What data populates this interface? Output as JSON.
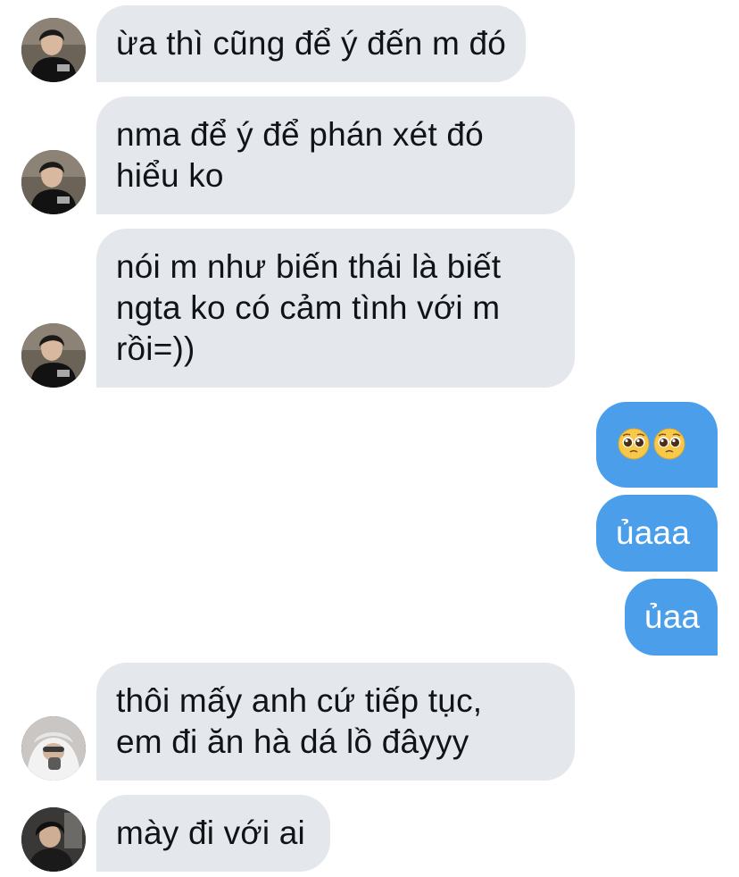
{
  "colors": {
    "incoming_bubble": "#e4e8ec",
    "outgoing_bubble": "#4b9ee9",
    "incoming_text": "#111417",
    "outgoing_text": "#ffffff"
  },
  "messages": [
    {
      "direction": "incoming",
      "sender_avatar": "avatar-boy-black-hoodie",
      "lines": [
        "ừa thì cũng để ý đến m đó"
      ]
    },
    {
      "direction": "incoming",
      "sender_avatar": "avatar-boy-black-hoodie",
      "lines": [
        "nma để ý để phán xét đó",
        "hiểu ko"
      ]
    },
    {
      "direction": "incoming",
      "sender_avatar": "avatar-boy-black-hoodie",
      "lines": [
        "nói m như biến thái là biết",
        "ngta ko có cảm tình với m",
        "rồi=))"
      ]
    },
    {
      "direction": "outgoing",
      "emoji": [
        "pleading-face-emoji",
        "pleading-face-emoji"
      ]
    },
    {
      "direction": "outgoing",
      "lines": [
        "ủaaa"
      ]
    },
    {
      "direction": "outgoing",
      "lines": [
        "ủaa"
      ]
    },
    {
      "direction": "incoming",
      "sender_avatar": "avatar-white-hoodie-person",
      "lines": [
        "thôi mấy anh cứ tiếp tục,",
        "em đi ăn hà dá lồ đâyyy"
      ]
    },
    {
      "direction": "incoming",
      "sender_avatar": "avatar-dark-hair-person",
      "lines": [
        "mày đi với ai"
      ]
    }
  ]
}
